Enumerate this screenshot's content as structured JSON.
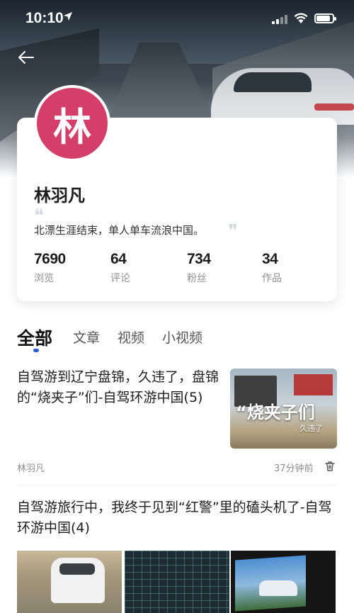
{
  "status_bar": {
    "time": "10:10",
    "battery_level": 0.85
  },
  "profile": {
    "avatar_char": "林",
    "name": "林羽凡",
    "bio": "北漂生涯结束，单人单车流浪中国。",
    "quote_open": "❝",
    "quote_close": "❞",
    "avatar_color": "#d43f6a",
    "stats": [
      {
        "value": "7690",
        "label": "浏览"
      },
      {
        "value": "64",
        "label": "评论"
      },
      {
        "value": "734",
        "label": "粉丝"
      },
      {
        "value": "34",
        "label": "作品"
      }
    ]
  },
  "tabs": [
    {
      "label": "全部",
      "active": true
    },
    {
      "label": "文章",
      "active": false
    },
    {
      "label": "视频",
      "active": false
    },
    {
      "label": "小视频",
      "active": false
    }
  ],
  "accent_color": "#2b5fd9",
  "articles": [
    {
      "title": "自驾游到辽宁盘锦，久违了，盘锦的“烧夹子”们-自驾环游中国(5)",
      "thumb_caption_big": "“烧夹子们",
      "thumb_caption_small": "久违了",
      "author": "林羽凡",
      "time": "37分钟前"
    },
    {
      "title": "自驾游旅行中，我终于见到“红警”里的磕头机了-自驾环游中国(4)"
    }
  ]
}
